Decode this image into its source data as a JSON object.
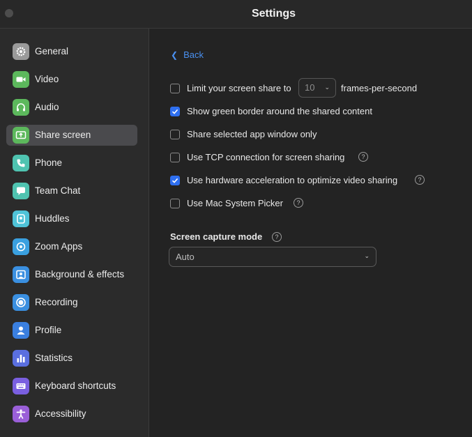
{
  "window": {
    "title": "Settings"
  },
  "sidebar": {
    "items": [
      {
        "label": "General",
        "icon": "gear-icon",
        "color": "#9a9a9a",
        "active": false
      },
      {
        "label": "Video",
        "icon": "video-camera-icon",
        "color": "#5cb85c",
        "active": false
      },
      {
        "label": "Audio",
        "icon": "headphones-icon",
        "color": "#5cb85c",
        "active": false
      },
      {
        "label": "Share screen",
        "icon": "share-screen-icon",
        "color": "#5cb85c",
        "active": true
      },
      {
        "label": "Phone",
        "icon": "phone-icon",
        "color": "#4fc3b0",
        "active": false
      },
      {
        "label": "Team Chat",
        "icon": "chat-bubble-icon",
        "color": "#4fc3b0",
        "active": false
      },
      {
        "label": "Huddles",
        "icon": "huddles-icon",
        "color": "#4fc3d8",
        "active": false
      },
      {
        "label": "Zoom Apps",
        "icon": "apps-icon",
        "color": "#3aa0e0",
        "active": false
      },
      {
        "label": "Background & effects",
        "icon": "background-portrait-icon",
        "color": "#3a8fe0",
        "active": false
      },
      {
        "label": "Recording",
        "icon": "record-icon",
        "color": "#3a8fe0",
        "active": false
      },
      {
        "label": "Profile",
        "icon": "person-icon",
        "color": "#3a7fe0",
        "active": false
      },
      {
        "label": "Statistics",
        "icon": "bar-chart-icon",
        "color": "#5a6fe0",
        "active": false
      },
      {
        "label": "Keyboard shortcuts",
        "icon": "keyboard-icon",
        "color": "#7a5fe0",
        "active": false
      },
      {
        "label": "Accessibility",
        "icon": "accessibility-icon",
        "color": "#9a5fd8",
        "active": false
      }
    ]
  },
  "content": {
    "back_label": "Back",
    "options": [
      {
        "label": "Limit your screen share to",
        "checked": false,
        "help": false,
        "fps_value": "10",
        "fps_suffix": "frames-per-second"
      },
      {
        "label": "Show green border around the shared content",
        "checked": true,
        "help": false
      },
      {
        "label": "Share selected app window only",
        "checked": false,
        "help": false
      },
      {
        "label": "Use TCP connection for screen sharing",
        "checked": false,
        "help": true
      },
      {
        "label": "Use hardware acceleration to optimize video sharing",
        "checked": true,
        "help": true
      },
      {
        "label": "Use Mac System Picker",
        "checked": false,
        "help": true
      }
    ],
    "capture_mode": {
      "title": "Screen capture mode",
      "value": "Auto"
    }
  },
  "colors": {
    "accent": "#2e6ff0",
    "link": "#4a90f0",
    "background": "#232323",
    "sidebar": "#2b2b2b"
  }
}
